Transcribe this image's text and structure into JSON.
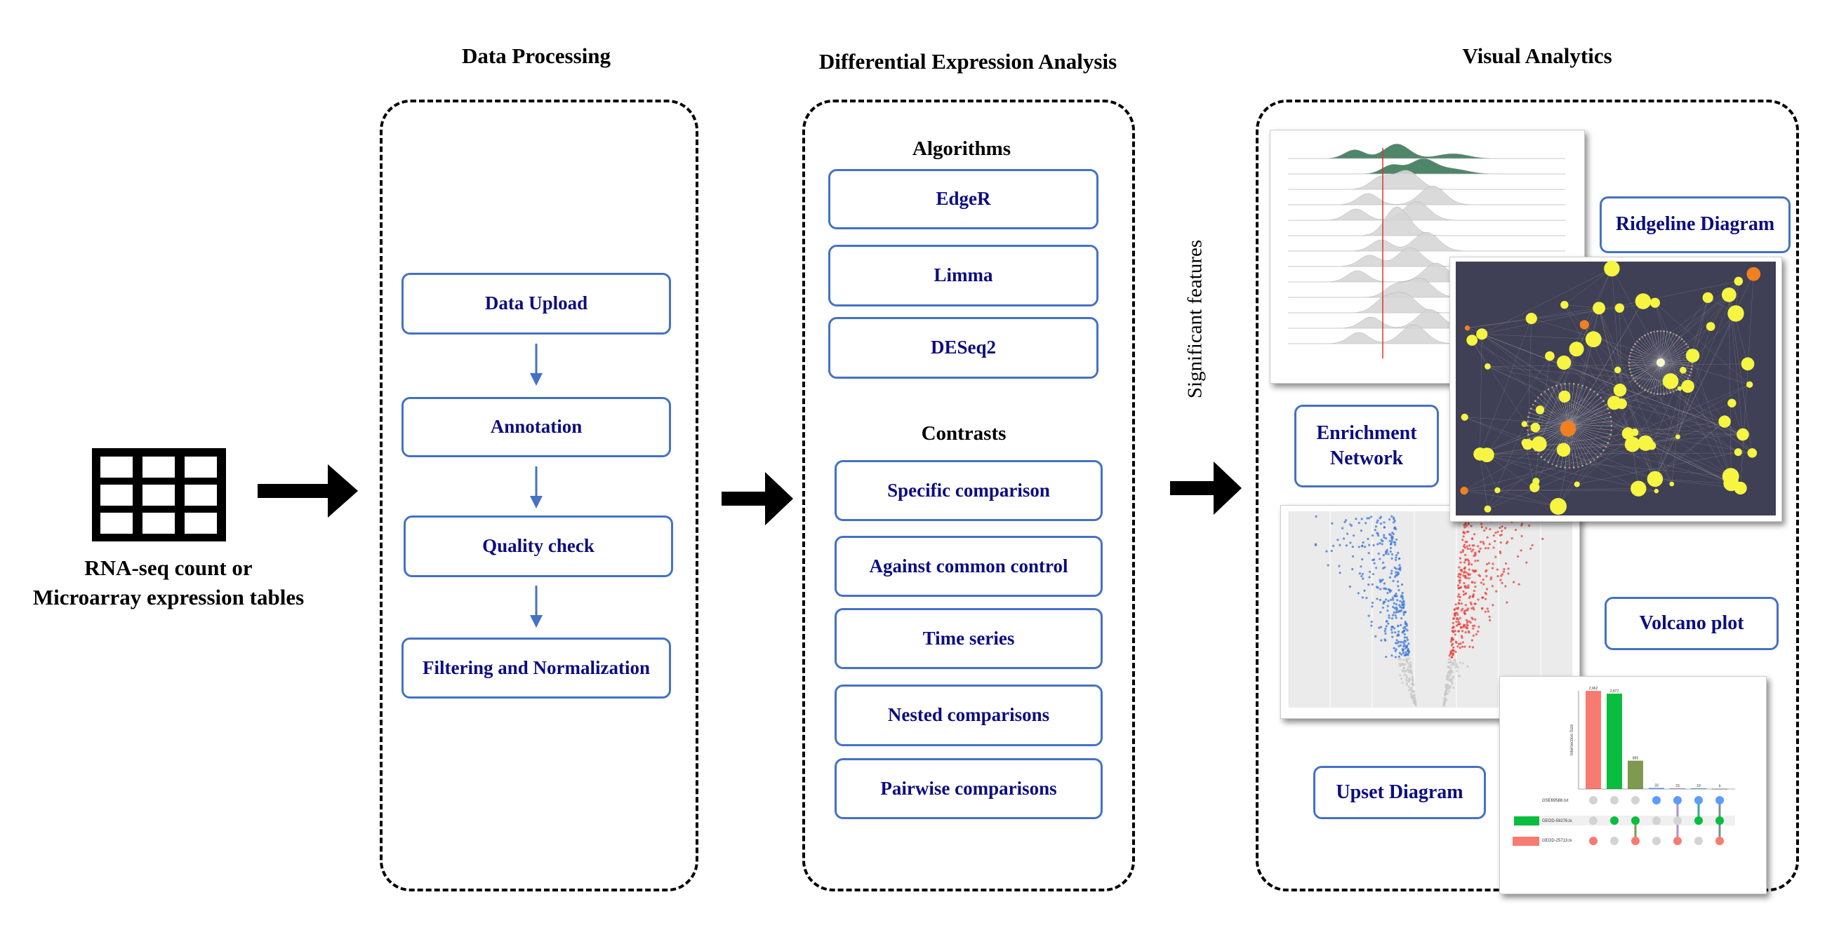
{
  "input": {
    "line1": "RNA-seq count or",
    "line2": "Microarray expression tables",
    "icon": "table-grid-icon"
  },
  "data_processing": {
    "title": "Data Processing",
    "steps": [
      "Data Upload",
      "Annotation",
      "Quality check",
      "Filtering and Normalization"
    ]
  },
  "differential_expression": {
    "title": "Differential Expression Analysis",
    "algorithms_heading": "Algorithms",
    "algorithms": [
      "EdgeR",
      "Limma",
      "DESeq2"
    ],
    "contrasts_heading": "Contrasts",
    "contrasts": [
      "Specific comparison",
      "Against common control",
      "Time series",
      "Nested comparisons",
      "Pairwise comparisons"
    ]
  },
  "connector_label": "Significant features",
  "visual_analytics": {
    "title": "Visual Analytics",
    "labels": {
      "ridgeline": "Ridgeline Diagram",
      "enrichment_line1": "Enrichment",
      "enrichment_line2": "Network",
      "volcano": "Volcano plot",
      "upset": "Upset Diagram"
    },
    "upset": {
      "sets": [
        "GSE69588.txt",
        "GEOD-59276.tx",
        "GEOD-25713.tx"
      ],
      "intersection_sizes": [
        2962,
        2877,
        855,
        33,
        23,
        19,
        9
      ],
      "intersection_labels": [
        "2,962",
        "2,877",
        "855",
        "33",
        "23",
        "19",
        "9"
      ],
      "y_axis_label": "Intersection Size"
    }
  },
  "colors": {
    "box_border": "#4472c4",
    "box_text": "#0d0d80",
    "arrow_small": "#4472c4",
    "volcano_up": "#e8403a",
    "volcano_down": "#3a74d8",
    "network_node": "#f5f542",
    "ridge_sig": "#3d7a5a"
  }
}
